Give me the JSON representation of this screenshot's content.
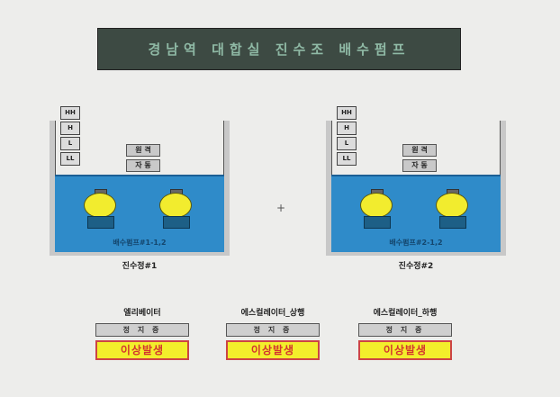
{
  "header": {
    "title": "경남역 대합실 진수조 배수펌프"
  },
  "tanks": [
    {
      "name": "진수정#1",
      "levels": [
        "HH",
        "H",
        "L",
        "LL"
      ],
      "mode_remote": "원 격",
      "mode_auto": "자 동",
      "pump_label": "배수펌프#1-1,2"
    },
    {
      "name": "진수정#2",
      "levels": [
        "HH",
        "H",
        "L",
        "LL"
      ],
      "mode_remote": "원 격",
      "mode_auto": "자 동",
      "pump_label": "배수펌프#2-1,2"
    }
  ],
  "center_marker": "+",
  "panels": [
    {
      "title": "엘리베이터",
      "status": "정 지 중",
      "alarm": "이상발생"
    },
    {
      "title": "에스컬레이터_상행",
      "status": "정 지 중",
      "alarm": "이상발생"
    },
    {
      "title": "에스컬레이터_하행",
      "status": "정 지 중",
      "alarm": "이상발생"
    }
  ],
  "colors": {
    "water": "#2f8bc9",
    "pump": "#f2ec2e",
    "alarm_bg": "#f3ee2b",
    "alarm_text": "#d3352e",
    "banner_bg": "#3d4a43"
  }
}
